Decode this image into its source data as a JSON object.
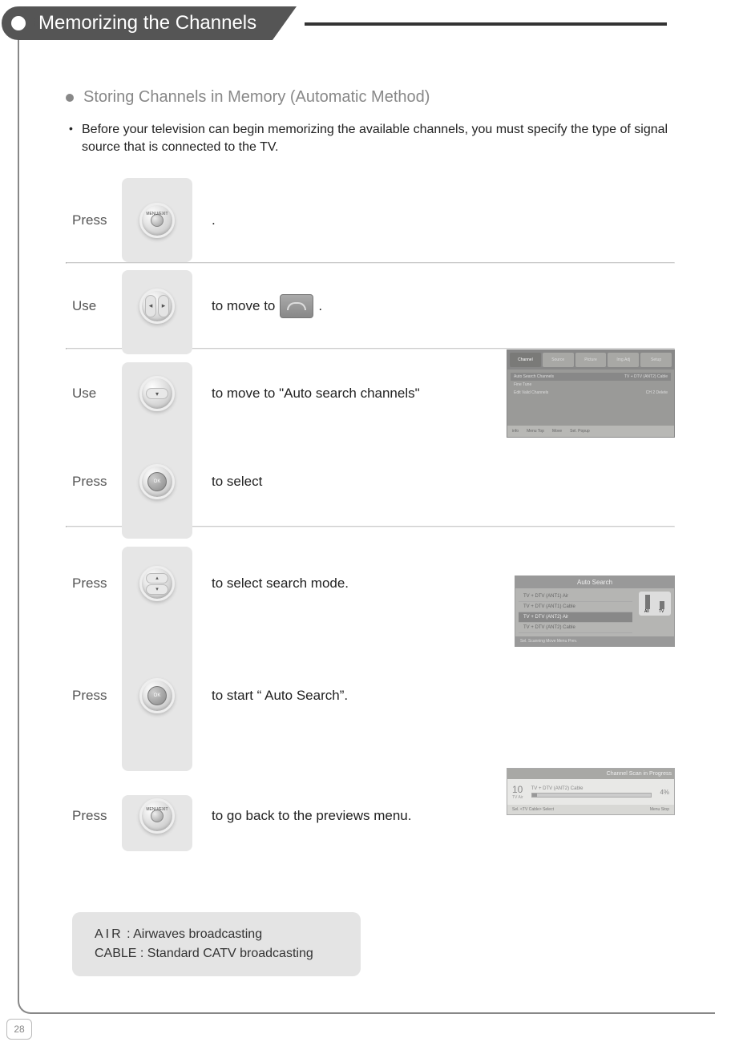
{
  "page_number": "28",
  "header": {
    "title": "Memorizing the Channels"
  },
  "section": {
    "title": "Storing Channels in Memory (Automatic Method)",
    "intro": "Before your television can begin memorizing the available channels, you must specify the type of signal source that is connected to the TV."
  },
  "steps": [
    {
      "action": "Press",
      "btn": "menu",
      "desc_pre": "",
      "desc_post": "."
    },
    {
      "action": "Use",
      "btn": "lr",
      "desc_pre": "to move to ",
      "desc_post": ".",
      "has_dest_icon": true
    },
    {
      "action": "Use",
      "btn": "down",
      "desc_pre": "to move to \"Auto search channels\"",
      "desc_post": ""
    },
    {
      "action": "Press",
      "btn": "ok",
      "desc_pre": "to select",
      "desc_post": ""
    },
    {
      "action": "Press",
      "btn": "updown",
      "desc_pre": "to select search mode.",
      "desc_post": ""
    },
    {
      "action": "Press",
      "btn": "ok",
      "desc_pre": "to start “ Auto Search”.",
      "desc_post": ""
    },
    {
      "action": "Press",
      "btn": "menu",
      "desc_pre": "to go back to the previews menu.",
      "desc_post": ""
    }
  ],
  "osd1": {
    "tabs": [
      "Channel",
      "Source",
      "Picture",
      "Img.Adj",
      "Setup"
    ],
    "rows": [
      {
        "l": "Auto Search Channels",
        "r": "TV + DTV (ANT2) Cable",
        "hl": true
      },
      {
        "l": "Fine Tune",
        "r": ""
      },
      {
        "l": "Edit Valid Channels",
        "r": "CH   2        Delete"
      }
    ],
    "foot": [
      "info",
      "Menu Top",
      "Move",
      "Sel. Popup"
    ]
  },
  "osd2": {
    "title": "Auto Search",
    "options": [
      "TV + DTV (ANT1) Air",
      "TV + DTV (ANT1) Cable",
      "TV + DTV (ANT2) Air",
      "TV + DTV (ANT2) Cable"
    ],
    "toggle_labels": [
      "All",
      "TV"
    ],
    "foot": "Sel.  Scanning   Move  Menu  Prev."
  },
  "osd3": {
    "header": "Channel Scan in Progress",
    "ch_num": "10",
    "ch_type": "TV Air",
    "src": "TV + DTV (ANT2) Cable",
    "pct": "4%",
    "foot_l": "Sel.  <TV Cable> Select",
    "foot_r": "Menu   Stop"
  },
  "note": {
    "air_label": "AIR",
    "air_desc": " : Airwaves broadcasting",
    "cable_label": "CABLE",
    "cable_desc": " : Standard CATV broadcasting"
  }
}
